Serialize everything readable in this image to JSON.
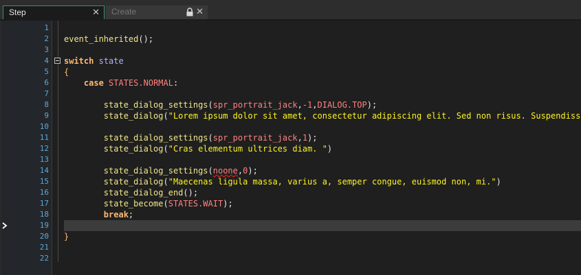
{
  "tabs": [
    {
      "label": "Step",
      "active": true,
      "close": "✕"
    },
    {
      "label": "Create",
      "active": false,
      "close": "✕",
      "locked": true
    }
  ],
  "current_line": 19,
  "colors": {
    "accent": "#3a8f73",
    "line_number": "#5fa8d6",
    "function": "#f0e68c",
    "keyword": "#ffb871",
    "variable": "#b2b1ff",
    "constant": "#ff8080",
    "string": "#fcf320",
    "current_line_bg": "#3c3c3c"
  },
  "lines": [
    {
      "n": "1",
      "tokens": []
    },
    {
      "n": "2",
      "tokens": [
        {
          "t": "event_inherited",
          "c": "t-func"
        },
        {
          "t": "();",
          "c": "t-punc"
        }
      ]
    },
    {
      "n": "3",
      "tokens": []
    },
    {
      "n": "4",
      "fold": true,
      "tokens": [
        {
          "t": "switch",
          "c": "t-kw"
        },
        {
          "t": " ",
          "c": "t-punc"
        },
        {
          "t": "state",
          "c": "t-var"
        }
      ]
    },
    {
      "n": "5",
      "tokens": [
        {
          "t": "{",
          "c": "t-kw2"
        }
      ]
    },
    {
      "n": "6",
      "tokens": [
        {
          "t": "    ",
          "c": "t-punc"
        },
        {
          "t": "case",
          "c": "t-kw"
        },
        {
          "t": " ",
          "c": "t-punc"
        },
        {
          "t": "STATES.NORMAL",
          "c": "t-const"
        },
        {
          "t": ":",
          "c": "t-punc"
        }
      ]
    },
    {
      "n": "7",
      "tokens": []
    },
    {
      "n": "8",
      "tokens": [
        {
          "t": "        ",
          "c": "t-punc"
        },
        {
          "t": "state_dialog_settings",
          "c": "t-func"
        },
        {
          "t": "(",
          "c": "t-punc"
        },
        {
          "t": "spr_portrait_jack",
          "c": "t-res"
        },
        {
          "t": ",",
          "c": "t-punc"
        },
        {
          "t": "-1",
          "c": "t-num"
        },
        {
          "t": ",",
          "c": "t-punc"
        },
        {
          "t": "DIALOG.TOP",
          "c": "t-const"
        },
        {
          "t": ");",
          "c": "t-punc"
        }
      ]
    },
    {
      "n": "9",
      "tokens": [
        {
          "t": "        ",
          "c": "t-punc"
        },
        {
          "t": "state_dialog",
          "c": "t-func"
        },
        {
          "t": "(",
          "c": "t-punc"
        },
        {
          "t": "\"Lorem ipsum dolor sit amet, consectetur adipiscing elit. Sed non risus. Suspendisse le",
          "c": "t-str"
        }
      ]
    },
    {
      "n": "10",
      "tokens": []
    },
    {
      "n": "11",
      "tokens": [
        {
          "t": "        ",
          "c": "t-punc"
        },
        {
          "t": "state_dialog_settings",
          "c": "t-func"
        },
        {
          "t": "(",
          "c": "t-punc"
        },
        {
          "t": "spr_portrait_jack",
          "c": "t-res"
        },
        {
          "t": ",",
          "c": "t-punc"
        },
        {
          "t": "1",
          "c": "t-num"
        },
        {
          "t": ");",
          "c": "t-punc"
        }
      ]
    },
    {
      "n": "12",
      "tokens": [
        {
          "t": "        ",
          "c": "t-punc"
        },
        {
          "t": "state_dialog",
          "c": "t-func"
        },
        {
          "t": "(",
          "c": "t-punc"
        },
        {
          "t": "\"Cras elementum ultrices diam. \"",
          "c": "t-str"
        },
        {
          "t": ")",
          "c": "t-punc"
        }
      ]
    },
    {
      "n": "13",
      "tokens": []
    },
    {
      "n": "14",
      "tokens": [
        {
          "t": "        ",
          "c": "t-punc"
        },
        {
          "t": "state_dialog_settings",
          "c": "t-func"
        },
        {
          "t": "(",
          "c": "t-punc"
        },
        {
          "t": "noone",
          "c": "t-const t-squig"
        },
        {
          "t": ",",
          "c": "t-punc"
        },
        {
          "t": "0",
          "c": "t-num"
        },
        {
          "t": ");",
          "c": "t-punc"
        }
      ]
    },
    {
      "n": "15",
      "tokens": [
        {
          "t": "        ",
          "c": "t-punc"
        },
        {
          "t": "state_dialog",
          "c": "t-func"
        },
        {
          "t": "(",
          "c": "t-punc"
        },
        {
          "t": "\"Maecenas ligula massa, varius a, semper congue, euismod non, mi.\"",
          "c": "t-str"
        },
        {
          "t": ")",
          "c": "t-punc"
        }
      ]
    },
    {
      "n": "16",
      "tokens": [
        {
          "t": "        ",
          "c": "t-punc"
        },
        {
          "t": "state_dialog_end",
          "c": "t-func"
        },
        {
          "t": "();",
          "c": "t-punc"
        }
      ]
    },
    {
      "n": "17",
      "tokens": [
        {
          "t": "        ",
          "c": "t-punc"
        },
        {
          "t": "state_become",
          "c": "t-func"
        },
        {
          "t": "(",
          "c": "t-punc"
        },
        {
          "t": "STATES.WAIT",
          "c": "t-const"
        },
        {
          "t": ");",
          "c": "t-punc"
        }
      ]
    },
    {
      "n": "18",
      "tokens": [
        {
          "t": "        ",
          "c": "t-punc"
        },
        {
          "t": "break",
          "c": "t-kw"
        },
        {
          "t": ";",
          "c": "t-punc"
        }
      ]
    },
    {
      "n": "19",
      "tokens": []
    },
    {
      "n": "20",
      "tokens": [
        {
          "t": "}",
          "c": "t-kw2"
        }
      ]
    },
    {
      "n": "21",
      "tokens": []
    },
    {
      "n": "22",
      "tokens": []
    }
  ]
}
